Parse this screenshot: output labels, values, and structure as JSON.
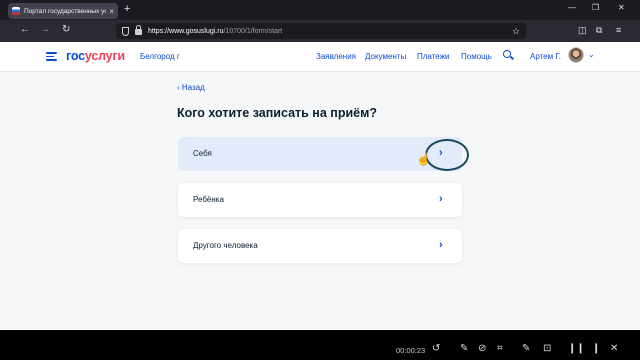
{
  "browser": {
    "tab_title": "Портал государственных услуг",
    "tab_close": "×",
    "new_tab": "+",
    "url_domain": "https://www.gosuslugi.ru",
    "url_path": "/10700/1/form/start",
    "controls": {
      "minimize": "—",
      "maximize": "❐",
      "close": "✕"
    },
    "nav": {
      "back": "←",
      "forward": "→",
      "reload": "↻"
    },
    "star": "☆",
    "right_tools": {
      "pocket": "◫",
      "extensions": "⧉",
      "menu": "≡"
    }
  },
  "header": {
    "logo_part1": "гос",
    "logo_part2": "услуги",
    "city": "Белгород г",
    "menu": [
      "Заявления",
      "Документы",
      "Платежи",
      "Помощь"
    ],
    "user_name": "Артем Г.",
    "user_chevron": "⌄",
    "colors": {
      "brand_blue": "#0d4cd3",
      "brand_red": "#ee3f58"
    }
  },
  "main": {
    "back_label": "‹ Назад",
    "title": "Кого хотите записать на приём?",
    "options": [
      {
        "label": "Себя",
        "chevron": "›"
      },
      {
        "label": "Ребёнка",
        "chevron": "›"
      },
      {
        "label": "Другого человека",
        "chevron": "›"
      }
    ],
    "selected_option_color": "#e3ebfb"
  },
  "video_bar": {
    "time": "00:00:23",
    "icons": [
      "↺",
      "✎",
      "⊘",
      "⌗",
      "✎",
      "⊡",
      "❙❙",
      "❙",
      "✕"
    ]
  }
}
